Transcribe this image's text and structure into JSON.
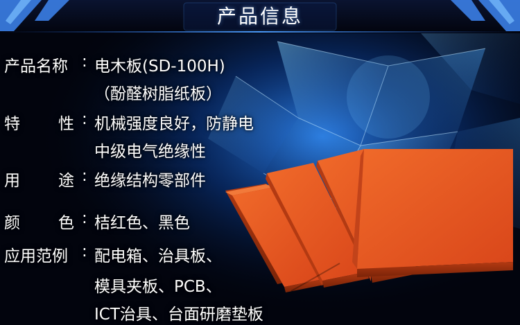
{
  "header": {
    "title": "产品信息"
  },
  "specs": {
    "name": {
      "label": "产品名称",
      "colon": ":",
      "line1": "电木板(SD-100H)",
      "line2": "（酚醛树脂纸板）"
    },
    "feature": {
      "label_a": "特",
      "label_b": "性",
      "colon": ":",
      "line1": "机械强度良好，防静电",
      "line2": "中级电气绝缘性"
    },
    "usage": {
      "label_a": "用",
      "label_b": "途",
      "colon": ":",
      "line1": "绝缘结构零部件"
    },
    "color": {
      "label_a": "颜",
      "label_b": "色",
      "colon": ":",
      "line1": "桔红色、黑色"
    },
    "application": {
      "label": "应用范例",
      "colon": ":",
      "line1": "配电箱、治具板、",
      "line2": "模具夹板、PCB、",
      "line3": "ICT治具、台面研磨垫板"
    }
  },
  "colors": {
    "board": "#e8541e",
    "board_edge": "#a8330f",
    "background": "#02040d",
    "accent": "#2a7be0"
  }
}
